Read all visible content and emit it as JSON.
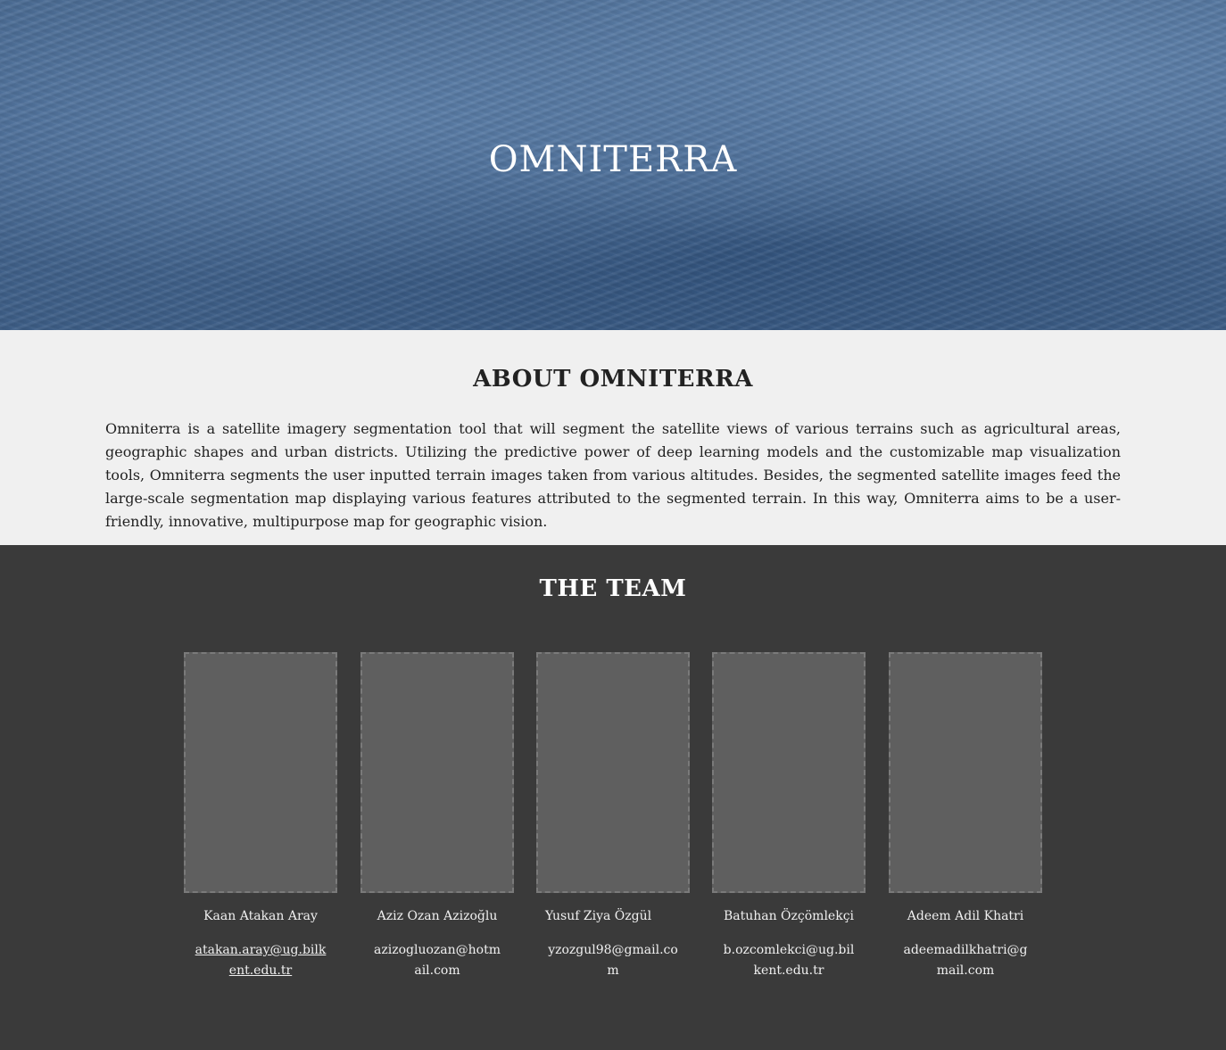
{
  "hero": {
    "title": "OMNITERRA"
  },
  "about": {
    "heading": "ABOUT OMNITERRA",
    "text": "Omniterra is a satellite imagery segmentation tool that will segment the satellite views of various terrains such as agricultural areas, geographic shapes and urban districts. Utilizing the predictive power of deep learning models and the customizable map visualization tools, Omniterra segments the user inputted terrain images taken from various altitudes. Besides, the segmented satellite images feed the large-scale segmentation map displaying various features attributed to the segmented terrain. In this way, Omniterra aims to be a user-friendly, innovative, multipurpose map for geographic vision."
  },
  "team": {
    "heading": "THE TEAM",
    "members": [
      {
        "name": "Kaan Atakan Aray",
        "email": "atakan.aray@ug.bilkent.edu.tr"
      },
      {
        "name": "Aziz Ozan Azizoğlu",
        "email": "azizogluozan@hotmail.com"
      },
      {
        "name": "Yusuf Ziya Özgül",
        "email": "yzozgul98@gmail.com"
      },
      {
        "name": "Batuhan Özçömlekçi",
        "email": "b.ozcomlekci@ug.bilkent.edu.tr"
      },
      {
        "name": "Adeem Adil Khatri",
        "email": "adeemadilkhatri@gmail.com"
      }
    ]
  },
  "colors": {
    "hero_blue": "#4a6b93",
    "about_bg": "#f0f0f0",
    "team_bg": "#3a3a3a",
    "photo_placeholder": "#5f5f5f"
  }
}
